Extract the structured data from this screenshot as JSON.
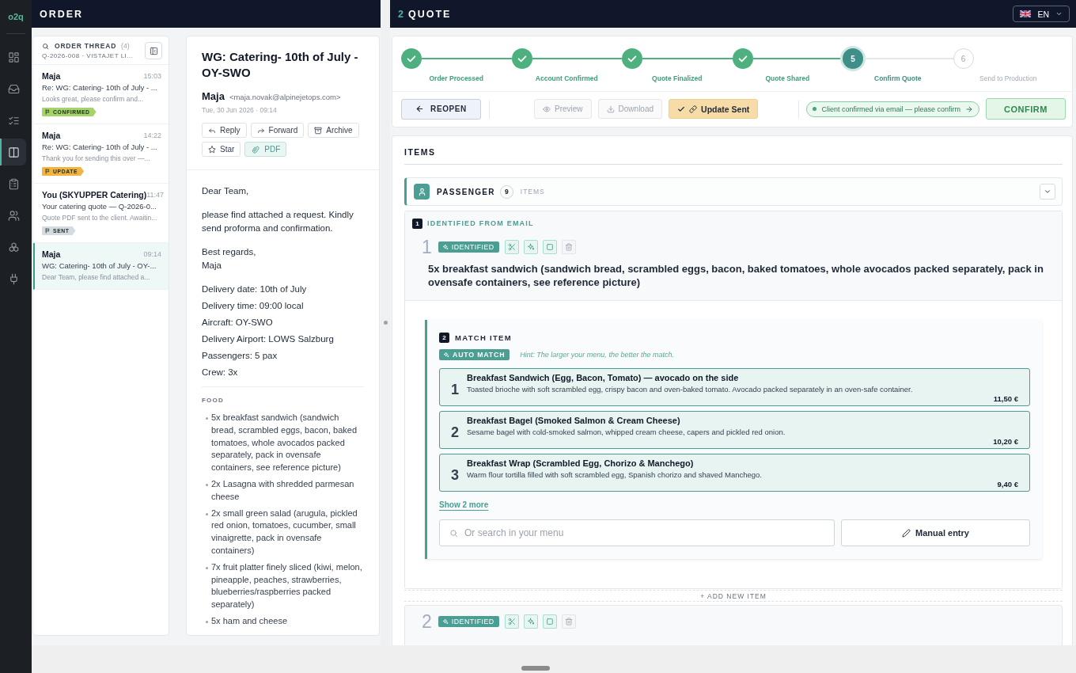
{
  "rail": {
    "logo": "o2q",
    "items": [
      {
        "selected": false
      },
      {
        "selected": false
      },
      {
        "selected": false
      },
      {
        "selected": true
      },
      {
        "selected": false
      },
      {
        "selected": false
      },
      {
        "selected": false
      },
      {
        "selected": false
      }
    ]
  },
  "order": {
    "title": "ORDER",
    "thread": {
      "title": "ORDER THREAD",
      "count": "(4)",
      "reference": "Q-2026-008 · VISTAJET LI...",
      "messages": [
        {
          "sender": "Maja",
          "time": "15:03",
          "subject": "Re: WG: Catering- 10th of July - ...",
          "preview": "Looks great, please confirm and...",
          "tag": {
            "label": "CONFIRMED",
            "color": "#a6d46c"
          },
          "selected": false
        },
        {
          "sender": "Maja",
          "time": "14:22",
          "subject": "Re: WG: Catering- 10th of July - ...",
          "preview": "Thank you for sending this over —...",
          "tag": {
            "label": "UPDATE",
            "color": "#f2b441"
          },
          "selected": false
        },
        {
          "sender": "You (SKYUPPER Catering)",
          "time": "11:47",
          "subject": "Your catering quote — Q-2026-0...",
          "preview": "Quote PDF sent to the client. Awaitin...",
          "tag": {
            "label": "SENT",
            "color": "#d5dbe3"
          },
          "selected": false
        },
        {
          "sender": "Maja",
          "time": "09:14",
          "subject": "WG: Catering- 10th of July - OY-...",
          "preview": "Dear Team, please find attached a...",
          "selected": true
        }
      ]
    },
    "email": {
      "subject": "WG: Catering- 10th of July - OY-SWO",
      "sender": "Maja",
      "address": "<maja.novak@alpinejetops.com>",
      "date": "Tue, 30 Jun 2026 · 09:14",
      "actions": [
        {
          "label": "Reply",
          "highlighted": false
        },
        {
          "label": "Forward",
          "highlighted": false
        },
        {
          "label": "Archive",
          "highlighted": false
        },
        {
          "label": "Star",
          "highlighted": false
        },
        {
          "label": "PDF",
          "highlighted": true
        }
      ],
      "paragraphs": [
        {
          "lines": [
            "Dear Team,"
          ]
        },
        {
          "lines": [
            "please find attached a request. Kindly send proforma and confirmation."
          ]
        },
        {
          "lines": [
            "Best regards,",
            "Maja"
          ]
        }
      ],
      "details": [
        "Delivery date: 10th of July",
        "Delivery time: 09:00 local",
        "Aircraft: OY-SWO",
        "Delivery Airport: LOWS Salzburg",
        "Passengers: 5 pax",
        "Crew: 3x"
      ],
      "section": "FOOD",
      "food": [
        "5x breakfast sandwich (sandwich bread, scrambled eggs, bacon, baked tomatoes, whole avocados packed separately, pack in ovensafe containers, see reference picture)",
        "2x Lasagna with shredded parmesan cheese",
        "2x small green salad (arugula, pickled red onion, tomatoes, cucumber, small vinaigrette, pack in ovensafe containers)",
        "7x fruit platter finely sliced (kiwi, melon, pineapple, peaches, strawberries, blueberries/raspberries packed separately)",
        "5x ham and cheese"
      ]
    }
  },
  "quote": {
    "number": "2",
    "title": "QUOTE",
    "language": "EN",
    "steps": [
      {
        "label": "Order Processed",
        "completed": true,
        "selected": false
      },
      {
        "label": "Account Confirmed",
        "completed": true,
        "selected": false
      },
      {
        "label": "Quote Finalized",
        "completed": true,
        "selected": false
      },
      {
        "label": "Quote Shared",
        "completed": true,
        "selected": false
      },
      {
        "number": "5",
        "label": "Confirm Quote",
        "completed": false,
        "selected": true
      },
      {
        "number": "6",
        "label": "Send to Production",
        "completed": false,
        "selected": false
      }
    ],
    "toolbar": {
      "reopen": "REOPEN",
      "actions": [
        {
          "kind": "button",
          "label": "Preview",
          "disabled": true
        },
        {
          "kind": "button",
          "label": "Download",
          "disabled": true
        },
        {
          "kind": "status",
          "label": "Update Sent",
          "disabled": false
        }
      ],
      "notice": "Client confirmed via email — please confirm",
      "confirm": "CONFIRM"
    },
    "items": {
      "title": "ITEMS",
      "group": {
        "name": "PASSENGER",
        "count": "9",
        "unit": "ITEMS",
        "expanded": true
      },
      "entries": [
        {
          "number": "1",
          "status": "IDENTIFIED",
          "section": {
            "step": "1",
            "title": "IDENTIFIED FROM EMAIL"
          },
          "text": "5x breakfast sandwich (sandwich bread, scrambled eggs, bacon, baked tomatoes, whole avocados packed separately, pack in ovensafe containers, see reference picture)",
          "match": {
            "step": "2",
            "title": "MATCH ITEM",
            "auto_label": "AUTO MATCH",
            "hint": "Hint: The larger your menu, the better the match.",
            "candidates": [
              {
                "rank": "1",
                "name": "Breakfast Sandwich (Egg, Bacon, Tomato) — avocado on the side",
                "description": "Toasted brioche with soft scrambled egg, crispy bacon and oven-baked tomato. Avocado packed separately in an oven-safe container.",
                "price": "11,50 €"
              },
              {
                "rank": "2",
                "name": "Breakfast Bagel (Smoked Salmon & Cream Cheese)",
                "description": "Sesame bagel with cold-smoked salmon, whipped cream cheese, capers and pickled red onion.",
                "price": "10,20 €"
              },
              {
                "rank": "3",
                "name": "Breakfast Wrap (Scrambled Egg, Chorizo & Manchego)",
                "description": "Warm flour tortilla filled with soft scrambled egg, Spanish chorizo and shaved Manchego.",
                "price": "9,40 €"
              }
            ],
            "more": "Show 2 more",
            "search_placeholder": "Or search in your menu",
            "manual": "Manual entry"
          }
        },
        {
          "number": "2",
          "status": "IDENTIFIED"
        }
      ],
      "add_label": "+ ADD NEW ITEM"
    }
  }
}
